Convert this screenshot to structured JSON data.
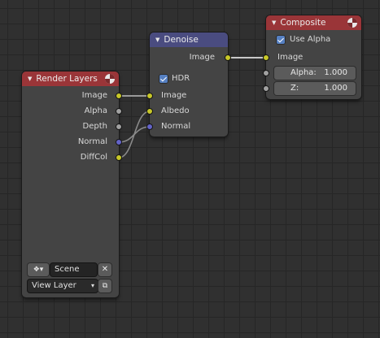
{
  "render_layers": {
    "title": "Render Layers",
    "outputs": [
      "Image",
      "Alpha",
      "Depth",
      "Normal",
      "DiffCol"
    ],
    "scene_label": "Scene",
    "clear_icon": "x",
    "view_layer_label": "View Layer"
  },
  "denoise": {
    "title": "Denoise",
    "output": "Image",
    "hdr_label": "HDR",
    "hdr_checked": true,
    "inputs": [
      "Image",
      "Albedo",
      "Normal"
    ]
  },
  "composite": {
    "title": "Composite",
    "use_alpha_label": "Use Alpha",
    "use_alpha_checked": true,
    "input_image": "Image",
    "alpha_label": "Alpha:",
    "alpha_value": "1.000",
    "z_label": "Z:",
    "z_value": "1.000"
  },
  "colors": {
    "background": "#303030",
    "header_red": "#9a3538",
    "header_purple": "#4a4c80",
    "socket_yellow": "#c7c729",
    "socket_gray": "#a1a1a1",
    "socket_blue": "#6363c7",
    "checkbox_blue": "#5680c2"
  },
  "icons": [
    "triangle-down-icon",
    "render-layer-icon",
    "scene-icon",
    "close-icon",
    "view-layer-copy-icon",
    "composite-icon"
  ]
}
